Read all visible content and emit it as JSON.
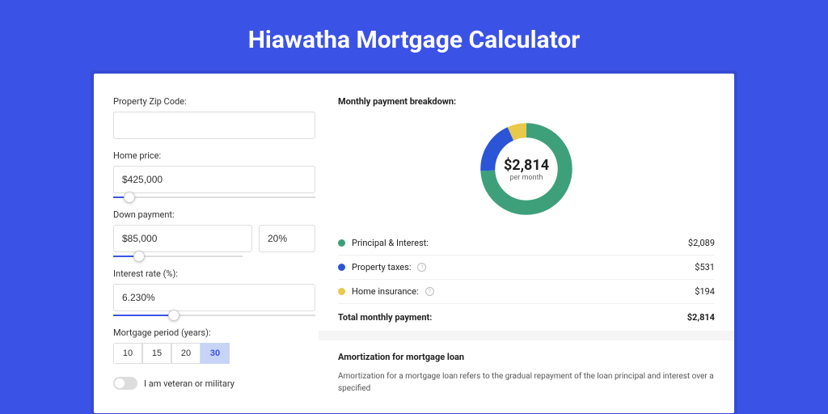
{
  "title": "Hiawatha Mortgage Calculator",
  "form": {
    "zip_label": "Property Zip Code:",
    "zip_value": "",
    "home_price_label": "Home price:",
    "home_price_value": "$425,000",
    "home_price_slider_pct": 8,
    "down_payment_label": "Down payment:",
    "down_payment_value": "$85,000",
    "down_payment_pct": "20%",
    "down_payment_slider_pct": 20,
    "interest_label": "Interest rate (%):",
    "interest_value": "6.230%",
    "interest_slider_pct": 30,
    "period_label": "Mortgage period (years):",
    "periods": [
      "10",
      "15",
      "20",
      "30"
    ],
    "period_selected": "30",
    "veteran_label": "I am veteran or military"
  },
  "breakdown": {
    "title": "Monthly payment breakdown:",
    "center_value": "$2,814",
    "center_label": "per month",
    "items": [
      {
        "label": "Principal & Interest:",
        "value": "$2,089",
        "color": "#3ea07a",
        "info": false,
        "pct": 74.2
      },
      {
        "label": "Property taxes:",
        "value": "$531",
        "color": "#2b54d6",
        "info": true,
        "pct": 18.9
      },
      {
        "label": "Home insurance:",
        "value": "$194",
        "color": "#e9c94b",
        "info": true,
        "pct": 6.9
      }
    ],
    "total_label": "Total monthly payment:",
    "total_value": "$2,814"
  },
  "amortization": {
    "title": "Amortization for mortgage loan",
    "text": "Amortization for a mortgage loan refers to the gradual repayment of the loan principal and interest over a specified"
  },
  "chart_data": {
    "type": "pie",
    "title": "Monthly payment breakdown",
    "series": [
      {
        "name": "Principal & Interest",
        "value": 2089,
        "color": "#3ea07a"
      },
      {
        "name": "Property taxes",
        "value": 531,
        "color": "#2b54d6"
      },
      {
        "name": "Home insurance",
        "value": 194,
        "color": "#e9c94b"
      }
    ],
    "total": 2814,
    "unit": "USD per month"
  }
}
